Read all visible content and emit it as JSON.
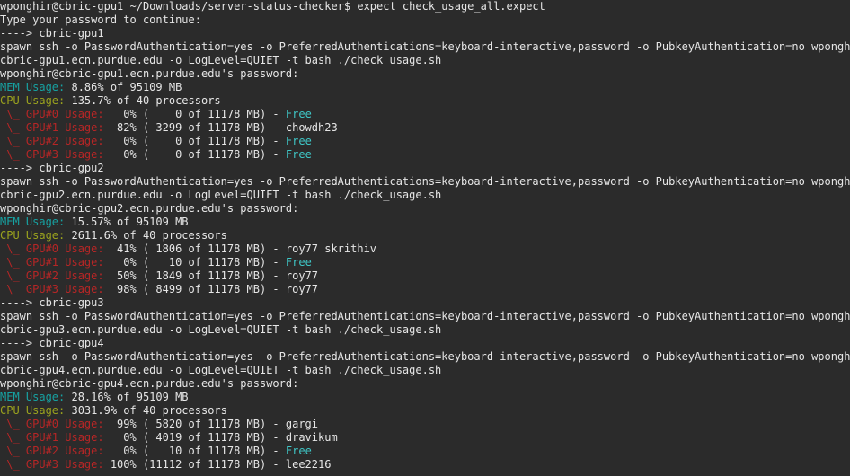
{
  "colors": {
    "background": "#2b2b2b",
    "text": "#e6e6e6",
    "mem_label": "#17a2a2",
    "cpu_label": "#9aa21e",
    "gpu_label": "#b62626",
    "free": "#3fc7c7"
  },
  "lines": [
    [
      {
        "t": "wponghir@cbric-gpu1 ~/Downloads/server-status-checker$ expect check_usage_all.expect",
        "c": "normal"
      }
    ],
    [
      {
        "t": "Type your password to continue:",
        "c": "normal"
      }
    ],
    [
      {
        "t": "----> cbric-gpu1",
        "c": "normal"
      }
    ],
    [
      {
        "t": "spawn ssh -o PasswordAuthentication=yes -o PreferredAuthentications=keyboard-interactive,password -o PubkeyAuthentication=no wponghir@",
        "c": "normal"
      }
    ],
    [
      {
        "t": "cbric-gpu1.ecn.purdue.edu -o LogLevel=QUIET -t bash ./check_usage.sh",
        "c": "normal"
      }
    ],
    [
      {
        "t": "wponghir@cbric-gpu1.ecn.purdue.edu's password:",
        "c": "normal"
      }
    ],
    [
      {
        "t": "MEM Usage:",
        "c": "teal"
      },
      {
        "t": " 8.86% of 95109 MB",
        "c": "normal"
      }
    ],
    [
      {
        "t": "CPU Usage:",
        "c": "olive"
      },
      {
        "t": " 135.7% of 40 processors",
        "c": "normal"
      }
    ],
    [
      {
        "t": " \\_ GPU#0 Usage:",
        "c": "red"
      },
      {
        "t": "   0% (    0 of 11178 MB) - ",
        "c": "normal"
      },
      {
        "t": "Free",
        "c": "free"
      }
    ],
    [
      {
        "t": " \\_ GPU#1 Usage:",
        "c": "red"
      },
      {
        "t": "  82% ( 3299 of 11178 MB) - chowdh23",
        "c": "normal"
      }
    ],
    [
      {
        "t": " \\_ GPU#2 Usage:",
        "c": "red"
      },
      {
        "t": "   0% (    0 of 11178 MB) - ",
        "c": "normal"
      },
      {
        "t": "Free",
        "c": "free"
      }
    ],
    [
      {
        "t": " \\_ GPU#3 Usage:",
        "c": "red"
      },
      {
        "t": "   0% (    0 of 11178 MB) - ",
        "c": "normal"
      },
      {
        "t": "Free",
        "c": "free"
      }
    ],
    [
      {
        "t": "----> cbric-gpu2",
        "c": "normal"
      }
    ],
    [
      {
        "t": "spawn ssh -o PasswordAuthentication=yes -o PreferredAuthentications=keyboard-interactive,password -o PubkeyAuthentication=no wponghir@",
        "c": "normal"
      }
    ],
    [
      {
        "t": "cbric-gpu2.ecn.purdue.edu -o LogLevel=QUIET -t bash ./check_usage.sh",
        "c": "normal"
      }
    ],
    [
      {
        "t": "wponghir@cbric-gpu2.ecn.purdue.edu's password:",
        "c": "normal"
      }
    ],
    [
      {
        "t": "MEM Usage:",
        "c": "teal"
      },
      {
        "t": " 15.57% of 95109 MB",
        "c": "normal"
      }
    ],
    [
      {
        "t": "CPU Usage:",
        "c": "olive"
      },
      {
        "t": " 2611.6% of 40 processors",
        "c": "normal"
      }
    ],
    [
      {
        "t": " \\_ GPU#0 Usage:",
        "c": "red"
      },
      {
        "t": "  41% ( 1806 of 11178 MB) - roy77 skrithiv",
        "c": "normal"
      }
    ],
    [
      {
        "t": " \\_ GPU#1 Usage:",
        "c": "red"
      },
      {
        "t": "   0% (   10 of 11178 MB) - ",
        "c": "normal"
      },
      {
        "t": "Free",
        "c": "free"
      }
    ],
    [
      {
        "t": " \\_ GPU#2 Usage:",
        "c": "red"
      },
      {
        "t": "  50% ( 1849 of 11178 MB) - roy77",
        "c": "normal"
      }
    ],
    [
      {
        "t": " \\_ GPU#3 Usage:",
        "c": "red"
      },
      {
        "t": "  98% ( 8499 of 11178 MB) - roy77",
        "c": "normal"
      }
    ],
    [
      {
        "t": "----> cbric-gpu3",
        "c": "normal"
      }
    ],
    [
      {
        "t": "spawn ssh -o PasswordAuthentication=yes -o PreferredAuthentications=keyboard-interactive,password -o PubkeyAuthentication=no wponghir@",
        "c": "normal"
      }
    ],
    [
      {
        "t": "cbric-gpu3.ecn.purdue.edu -o LogLevel=QUIET -t bash ./check_usage.sh",
        "c": "normal"
      }
    ],
    [
      {
        "t": "----> cbric-gpu4",
        "c": "normal"
      }
    ],
    [
      {
        "t": "spawn ssh -o PasswordAuthentication=yes -o PreferredAuthentications=keyboard-interactive,password -o PubkeyAuthentication=no wponghir@",
        "c": "normal"
      }
    ],
    [
      {
        "t": "cbric-gpu4.ecn.purdue.edu -o LogLevel=QUIET -t bash ./check_usage.sh",
        "c": "normal"
      }
    ],
    [
      {
        "t": "wponghir@cbric-gpu4.ecn.purdue.edu's password:",
        "c": "normal"
      }
    ],
    [
      {
        "t": "MEM Usage:",
        "c": "teal"
      },
      {
        "t": " 28.16% of 95109 MB",
        "c": "normal"
      }
    ],
    [
      {
        "t": "CPU Usage:",
        "c": "olive"
      },
      {
        "t": " 3031.9% of 40 processors",
        "c": "normal"
      }
    ],
    [
      {
        "t": " \\_ GPU#0 Usage:",
        "c": "red"
      },
      {
        "t": "  99% ( 5820 of 11178 MB) - gargi",
        "c": "normal"
      }
    ],
    [
      {
        "t": " \\_ GPU#1 Usage:",
        "c": "red"
      },
      {
        "t": "   0% ( 4019 of 11178 MB) - dravikum",
        "c": "normal"
      }
    ],
    [
      {
        "t": " \\_ GPU#2 Usage:",
        "c": "red"
      },
      {
        "t": "   0% (   10 of 11178 MB) - ",
        "c": "normal"
      },
      {
        "t": "Free",
        "c": "free"
      }
    ],
    [
      {
        "t": " \\_ GPU#3 Usage:",
        "c": "red"
      },
      {
        "t": " 100% (11112 of 11178 MB) - lee2216",
        "c": "normal"
      }
    ]
  ]
}
